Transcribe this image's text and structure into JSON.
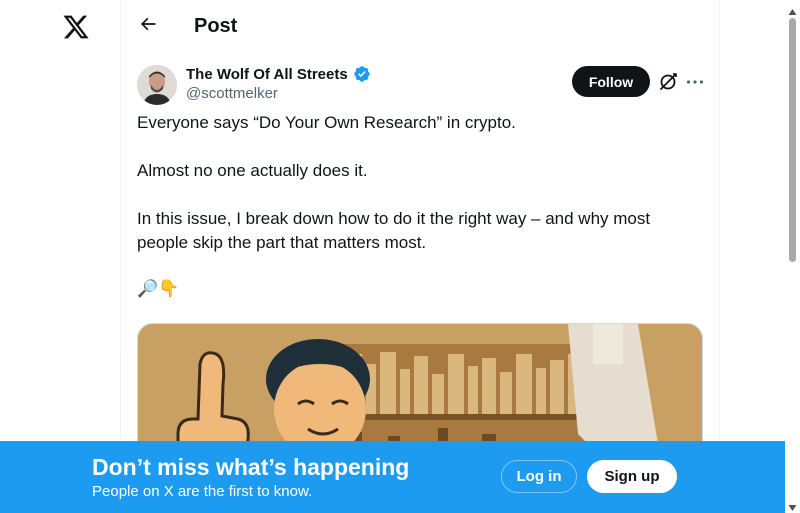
{
  "header": {
    "title": "Post"
  },
  "tweet": {
    "display_name": "The Wolf Of All Streets",
    "handle": "@scottmelker",
    "follow_label": "Follow",
    "paragraphs": [
      "Everyone says “Do Your Own Research” in crypto.",
      "Almost no one actually does it.",
      "In this issue, I break down how to do it the right way – and why most people skip the part that matters most."
    ],
    "emoji_line": "🔎👇"
  },
  "banner": {
    "title": "Don’t miss what’s happening",
    "subtitle": "People on X are the first to know.",
    "login_label": "Log in",
    "signup_label": "Sign up"
  },
  "icons": {
    "logo": "x-logo-icon",
    "back": "arrow-left-icon",
    "verified": "verified-badge-icon",
    "grok": "grok-icon",
    "more": "more-horizontal-icon"
  },
  "colors": {
    "accent": "#1d9bf0",
    "text": "#0f1419",
    "muted": "#536471",
    "follow_bg": "#0f1419"
  }
}
